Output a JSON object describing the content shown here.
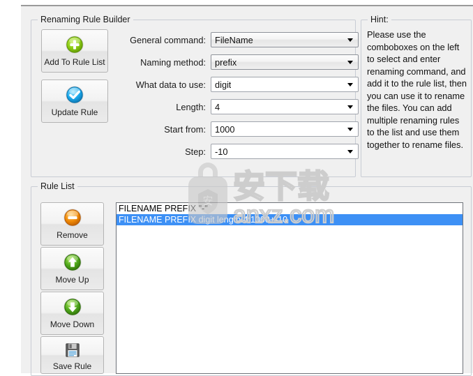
{
  "builder": {
    "title": "Renaming Rule Builder",
    "buttons": [
      {
        "name": "add-to-rule-list",
        "label": "Add To Rule List",
        "icon": "plus-circle-icon"
      },
      {
        "name": "update-rule",
        "label": "Update Rule",
        "icon": "check-circle-icon"
      }
    ],
    "fields": [
      {
        "label": "General command:",
        "value": "FileName",
        "style": "raised"
      },
      {
        "label": "Naming method:",
        "value": "prefix",
        "style": "raised"
      },
      {
        "label": "What data to use:",
        "value": "digit",
        "style": "flat"
      },
      {
        "label": "Length:",
        "value": "4",
        "style": "flat"
      },
      {
        "label": "Start from:",
        "value": "1000",
        "style": "flat"
      },
      {
        "label": "Step:",
        "value": "-10",
        "style": "flat"
      }
    ]
  },
  "hint": {
    "title": "Hint:",
    "body": "Please use the comboboxes on the left to select and enter renaming command, and add it to the rule list, then you can use it to rename the files. You can add multiple renaming rules to the list and use them together to rename files."
  },
  "rule_list": {
    "title": "Rule List",
    "buttons": [
      {
        "name": "remove",
        "label": "Remove",
        "icon": "minus-circle-icon"
      },
      {
        "name": "move-up",
        "label": "Move Up",
        "icon": "arrow-up-circle-icon"
      },
      {
        "name": "move-down",
        "label": "Move Down",
        "icon": "arrow-down-circle-icon"
      },
      {
        "name": "save-rule",
        "label": "Save Rule",
        "icon": "floppy-disk-icon"
      }
    ],
    "items": [
      {
        "text": "FILENAME PREFIX \"-\"",
        "selected": false
      },
      {
        "text": "FILENAME PREFIX digit length:4:1000+-10",
        "selected": true
      }
    ]
  },
  "watermark": {
    "text_cn": "安下载",
    "text_en": "anxz.com",
    "badge_char": "安"
  },
  "colors": {
    "selection_blue": "#3d90f5",
    "panel_bg": "#f0f0f0",
    "border": "#c8ccd4",
    "green": "#7ac70c",
    "blue": "#1ca7e8",
    "orange": "#f08000"
  }
}
